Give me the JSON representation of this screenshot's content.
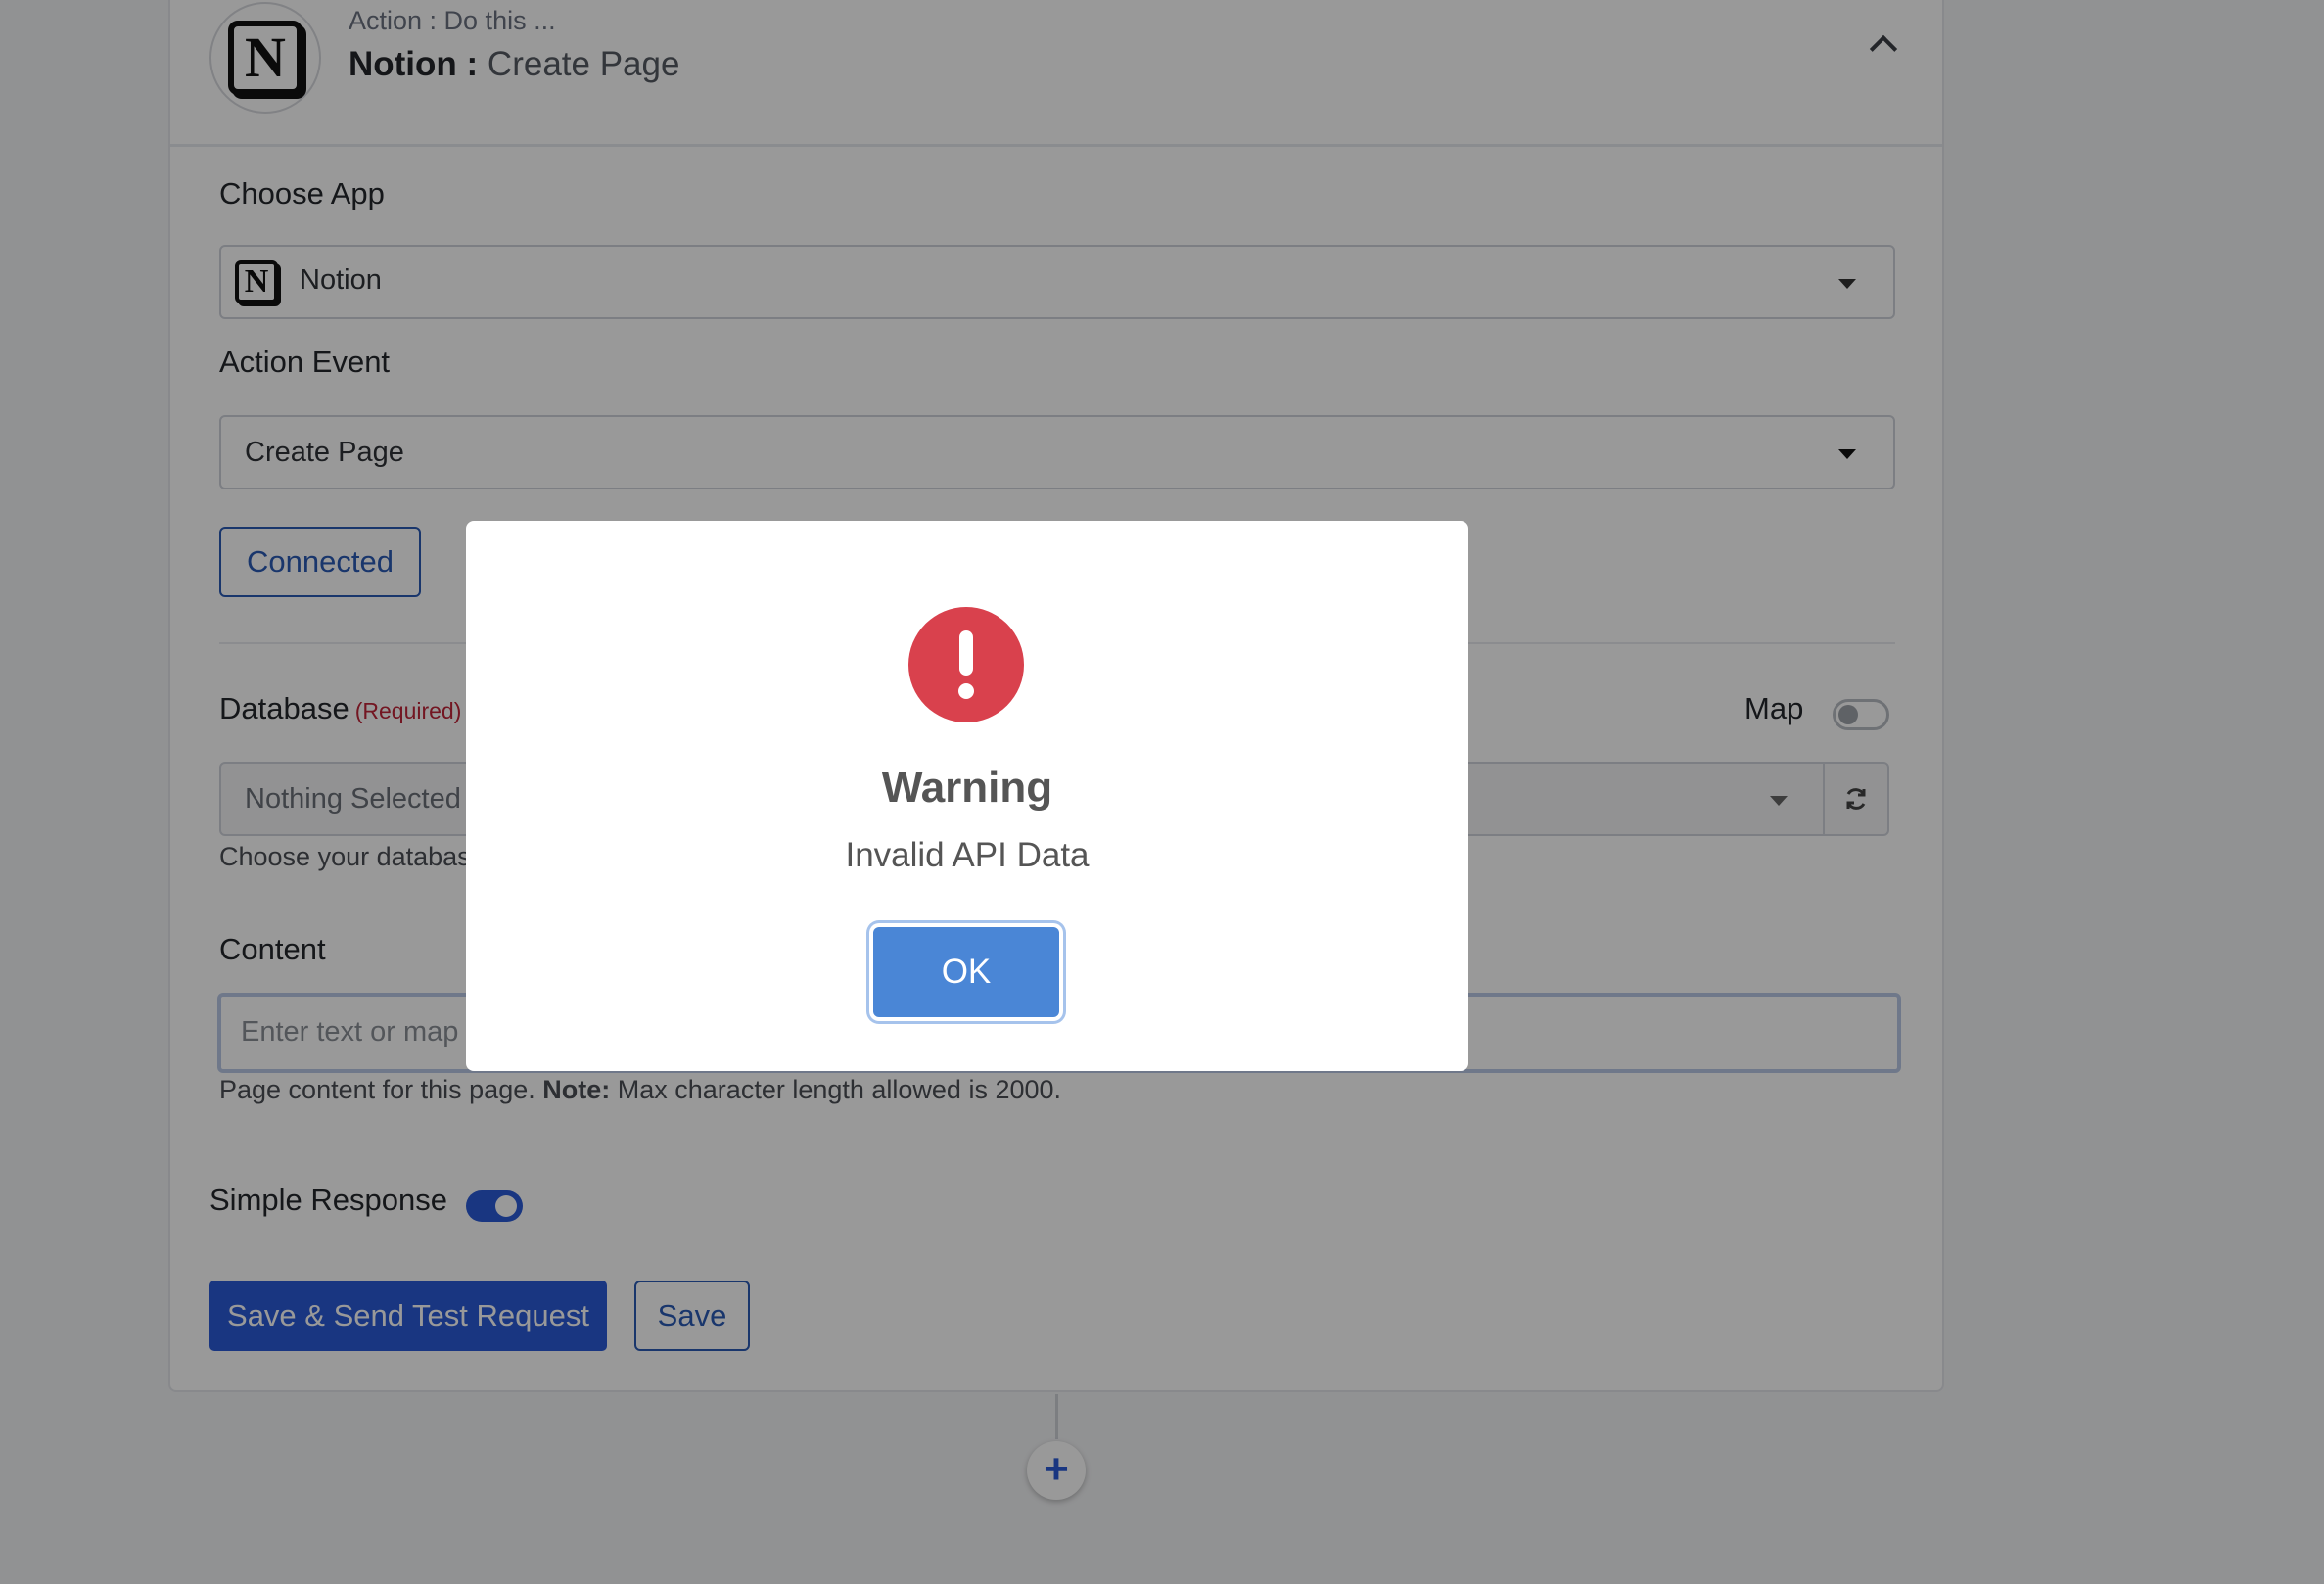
{
  "header": {
    "subtitle": "Action : Do this ...",
    "app_name": "Notion :",
    "event_name": "Create Page"
  },
  "choose_app": {
    "label": "Choose App",
    "value": "Notion"
  },
  "action_event": {
    "label": "Action Event",
    "value": "Create Page"
  },
  "connected_button": "Connected",
  "database": {
    "label": "Database",
    "required": "(Required)",
    "value": "Nothing Selected",
    "help": "Choose your database"
  },
  "map": {
    "label": "Map"
  },
  "content": {
    "label": "Content",
    "placeholder": "Enter text or map data",
    "help_prefix": "Page content for this page.",
    "help_note": "Note:",
    "help_suffix": "Max character length allowed is 2000."
  },
  "simple_response": {
    "label": "Simple Response"
  },
  "buttons": {
    "save_send": "Save & Send Test Request",
    "save": "Save"
  },
  "add_step": "+",
  "modal": {
    "title": "Warning",
    "message": "Invalid API Data",
    "ok": "OK"
  },
  "colors": {
    "accent": "#2b5bd7",
    "warning": "#d9414d",
    "required": "#c0263a"
  },
  "icons": [
    "notion-logo",
    "chevron-up-icon",
    "caret-down-icon",
    "refresh-icon",
    "warning-icon",
    "plus-icon"
  ]
}
